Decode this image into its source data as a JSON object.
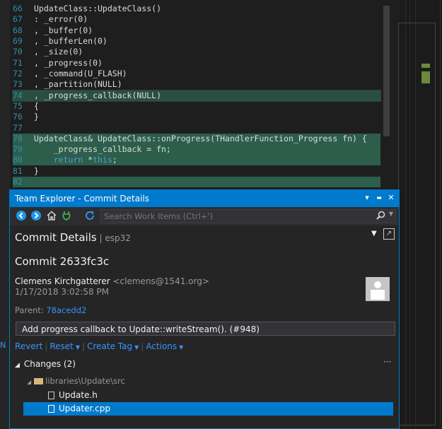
{
  "editor": {
    "lines": [
      {
        "no": "66",
        "text": "UpdateClass::UpdateClass()"
      },
      {
        "no": "67",
        "text": ": _error(0)"
      },
      {
        "no": "68",
        "text": ", _buffer(0)"
      },
      {
        "no": "69",
        "text": ", _bufferLen(0)"
      },
      {
        "no": "70",
        "text": ", _size(0)"
      },
      {
        "no": "71",
        "text": ", _progress(0)"
      },
      {
        "no": "72",
        "text": ", _command(U_FLASH)"
      },
      {
        "no": "73",
        "text": ", _partition(NULL)"
      },
      {
        "no": "74",
        "text": ", _progress_callback(NULL)"
      },
      {
        "no": "75",
        "text": "{"
      },
      {
        "no": "76",
        "text": "}"
      },
      {
        "no": "77",
        "text": ""
      },
      {
        "no": "78",
        "text": "UpdateClass& UpdateClass::onProgress(THandlerFunction_Progress fn) {"
      },
      {
        "no": "79",
        "text_pre": "    _progress_callback = fn;"
      },
      {
        "no": "80",
        "text_kw": "return",
        "text_kw2": "this",
        "text_rest_a": " *",
        "text_rest_b": ";"
      },
      {
        "no": "81",
        "text": "}"
      },
      {
        "no": "82",
        "text": ""
      }
    ]
  },
  "team_explorer": {
    "title": "Team Explorer - Commit Details",
    "title_dropdown": "▾",
    "title_pin": "▬",
    "title_close": "✕",
    "toolbar": {
      "back_icon": "back-icon",
      "forward_icon": "forward-icon",
      "home_icon": "home-icon",
      "connect_icon": "plug-icon",
      "refresh_icon": "refresh-icon"
    },
    "search": {
      "placeholder": "Search Work Items (Ctrl+')"
    },
    "header": {
      "title": "Commit Details",
      "separator": " | ",
      "repo": "esp32"
    },
    "commit": {
      "title": "Commit 2633fc3c",
      "author": "Clemens Kirchgatterer",
      "email": "<clemens@1541.org>",
      "date": "1/17/2018 3:02:58 PM",
      "parent_label": "Parent: ",
      "parent_hash": "78acedd2",
      "message": "Add progress callback to Update::writeStream(). (#948)"
    },
    "actions": {
      "revert": "Revert",
      "reset": "Reset",
      "create_tag": "Create Tag",
      "actions": "Actions"
    },
    "changes": {
      "header": "Changes (2)",
      "more": "···",
      "folder": "libraries\\Update\\src",
      "files": [
        "Update.h",
        "Updater.cpp"
      ]
    }
  },
  "side": {
    "text": "N"
  },
  "colors": {
    "accent": "#007acc",
    "highlight": "#2d5e4b",
    "link": "#3794ff"
  }
}
